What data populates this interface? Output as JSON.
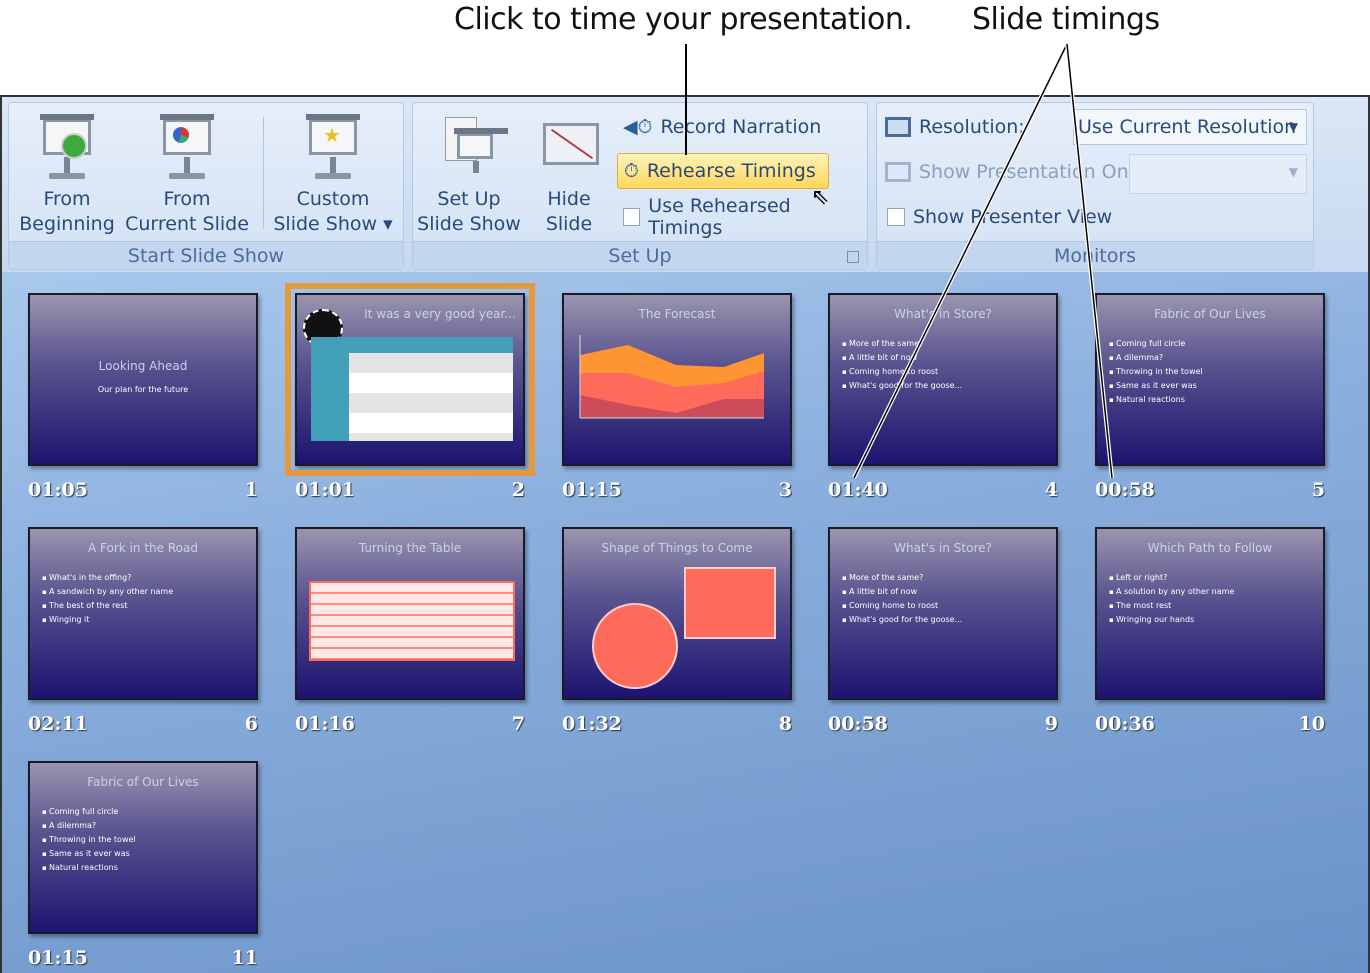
{
  "callouts": {
    "rehearse": "Click to time your presentation.",
    "timings": "Slide timings"
  },
  "ribbon": {
    "start_group": {
      "label": "Start Slide Show",
      "from_beginning": [
        "From",
        "Beginning"
      ],
      "from_current": [
        "From",
        "Current Slide"
      ],
      "custom": [
        "Custom",
        "Slide Show ▾"
      ]
    },
    "setup_group": {
      "label": "Set Up",
      "setup_show": [
        "Set Up",
        "Slide Show"
      ],
      "hide_slide": [
        "Hide",
        "Slide"
      ],
      "record_narration": "Record Narration",
      "rehearse_timings": "Rehearse Timings",
      "use_rehearsed": "Use Rehearsed Timings",
      "use_rehearsed_checked": false
    },
    "monitors_group": {
      "label": "Monitors",
      "resolution_label": "Resolution:",
      "resolution_value": "Use Current Resolution",
      "show_on_label": "Show Presentation On",
      "show_on_value": "",
      "presenter_view": "Show Presenter View",
      "presenter_view_checked": false
    }
  },
  "accent": "#e49a3c",
  "slides": [
    {
      "num": "1",
      "time": "01:05",
      "title": "Looking Ahead",
      "subtitle": "Our plan for the future",
      "bullets": []
    },
    {
      "num": "2",
      "time": "01:01",
      "title": "It was a very good year...",
      "bullets": [],
      "selected": true
    },
    {
      "num": "3",
      "time": "01:15",
      "title": "The Forecast",
      "bullets": []
    },
    {
      "num": "4",
      "time": "01:40",
      "title": "What's in Store?",
      "bullets": [
        "More of the same?",
        "A little bit of now",
        "Coming home to roost",
        "What's good for the goose..."
      ]
    },
    {
      "num": "5",
      "time": "00:58",
      "title": "Fabric of Our Lives",
      "bullets": [
        "Coming full circle",
        "A dilemma?",
        "Throwing in the towel",
        "Same as it ever was",
        "Natural reactions"
      ]
    },
    {
      "num": "6",
      "time": "02:11",
      "title": "A Fork in the Road",
      "bullets": [
        "What's in the offing?",
        "A sandwich by any other name",
        "The best of the rest",
        "Winging it"
      ]
    },
    {
      "num": "7",
      "time": "01:16",
      "title": "Turning the Table",
      "bullets": []
    },
    {
      "num": "8",
      "time": "01:32",
      "title": "Shape of Things to Come",
      "bullets": []
    },
    {
      "num": "9",
      "time": "00:58",
      "title": "What's in Store?",
      "bullets": [
        "More of the same?",
        "A little bit of now",
        "Coming home to roost",
        "What's good for the goose..."
      ]
    },
    {
      "num": "10",
      "time": "00:36",
      "title": "Which Path to Follow",
      "bullets": [
        "Left or right?",
        "A solution by any other name",
        "The most rest",
        "Wringing our hands"
      ]
    },
    {
      "num": "11",
      "time": "01:15",
      "title": "Fabric of Our Lives",
      "bullets": [
        "Coming full circle",
        "A dilemma?",
        "Throwing in the towel",
        "Same as it ever was",
        "Natural reactions"
      ]
    }
  ]
}
